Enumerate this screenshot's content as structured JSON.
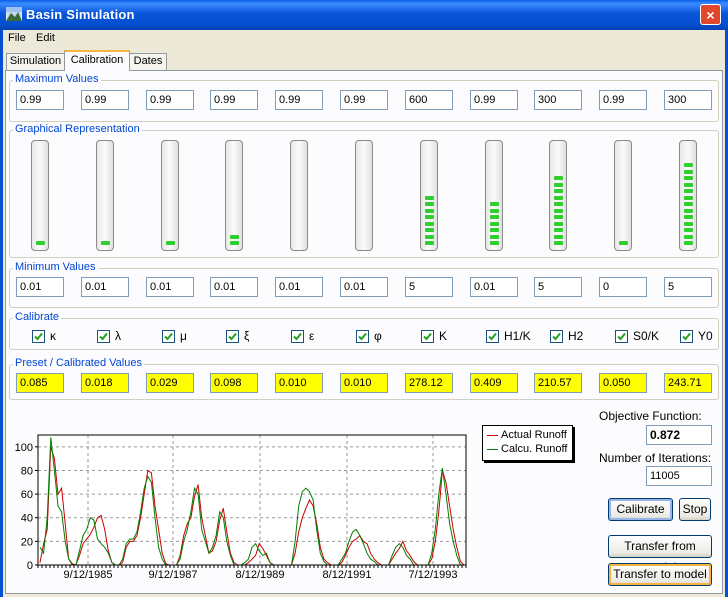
{
  "window": {
    "title": "Basin Simulation",
    "close_glyph": "×"
  },
  "menu": [
    "File",
    "Edit"
  ],
  "tabs": [
    "Simulation",
    "Calibration",
    "Dates"
  ],
  "active_tab": "Calibration",
  "groups": {
    "max": "Maximum Values",
    "graph": "Graphical Representation",
    "min": "Minimum Values",
    "calibrate": "Calibrate",
    "preset": "Preset / Calibrated Values"
  },
  "max_values": [
    "0.99",
    "0.99",
    "0.99",
    "0.99",
    "0.99",
    "0.99",
    "600",
    "0.99",
    "300",
    "0.99",
    "300"
  ],
  "min_values": [
    "0.01",
    "0.01",
    "0.01",
    "0.01",
    "0.01",
    "0.01",
    "5",
    "0.01",
    "5",
    "0",
    "5"
  ],
  "preset_values": [
    "0.085",
    "0.018",
    "0.029",
    "0.098",
    "0.010",
    "0.010",
    "278.12",
    "0.409",
    "210.57",
    "0.050",
    "243.71"
  ],
  "meter_levels": [
    0.09,
    0.02,
    0.03,
    0.1,
    0.0,
    0.0,
    0.47,
    0.41,
    0.71,
    0.05,
    0.81
  ],
  "params": [
    {
      "label": "κ",
      "checked": true
    },
    {
      "label": "λ",
      "checked": true
    },
    {
      "label": "μ",
      "checked": true
    },
    {
      "label": "ξ",
      "checked": true
    },
    {
      "label": "ε",
      "checked": true
    },
    {
      "label": "φ",
      "checked": true
    },
    {
      "label": "K",
      "checked": true
    },
    {
      "label": "H1/K",
      "checked": true
    },
    {
      "label": "H2",
      "checked": true
    },
    {
      "label": "S0/K",
      "checked": true
    },
    {
      "label": "Y0",
      "checked": true
    }
  ],
  "objective": {
    "label": "Objective Function:",
    "value": "0.872"
  },
  "iterations": {
    "label": "Number of Iterations:",
    "value": "11005"
  },
  "buttons": {
    "calibrate": "Calibrate",
    "stop": "Stop",
    "transfer_from": "Transfer from model",
    "transfer_to": "Transfer to model"
  },
  "colors": {
    "actual": "#cc0000",
    "calculated": "#007f00",
    "meter_fill": "#2fcf2f",
    "preset_bg": "#ffff00"
  },
  "chart_data": {
    "type": "line",
    "ylim": [
      0,
      110
    ],
    "yticks": [
      0,
      20,
      40,
      60,
      80,
      100
    ],
    "xticks": [
      "9/12/1985",
      "9/12/1987",
      "8/12/1989",
      "8/12/1991",
      "7/12/1993"
    ],
    "grid": true,
    "legend_position": "top-right",
    "series": [
      {
        "name": "Actual Runoff",
        "values": [
          2,
          18,
          30,
          100,
          90,
          60,
          65,
          35,
          5,
          1,
          0,
          8,
          18,
          22,
          26,
          32,
          40,
          42,
          30,
          12,
          2,
          0,
          0,
          2,
          15,
          20,
          20,
          25,
          40,
          60,
          80,
          78,
          50,
          30,
          10,
          1,
          0,
          0,
          0,
          8,
          25,
          35,
          40,
          58,
          68,
          40,
          25,
          10,
          12,
          20,
          38,
          48,
          28,
          10,
          2,
          0,
          0,
          0,
          2,
          5,
          8,
          18,
          14,
          8,
          2,
          0,
          0,
          0,
          0,
          0,
          0,
          10,
          28,
          40,
          48,
          55,
          50,
          35,
          15,
          5,
          2,
          0,
          0,
          0,
          2,
          8,
          15,
          20,
          22,
          25,
          20,
          18,
          10,
          5,
          2,
          0,
          0,
          0,
          5,
          10,
          14,
          20,
          12,
          8,
          3,
          0,
          0,
          0,
          0,
          5,
          20,
          45,
          80,
          70,
          50,
          30,
          15,
          3,
          0
        ]
      },
      {
        "name": "Calcu. Runoff",
        "values": [
          15,
          10,
          40,
          108,
          80,
          50,
          45,
          20,
          5,
          0,
          0,
          12,
          25,
          30,
          40,
          38,
          22,
          18,
          15,
          10,
          2,
          0,
          0,
          5,
          18,
          22,
          22,
          28,
          45,
          65,
          75,
          70,
          40,
          15,
          5,
          0,
          0,
          0,
          0,
          5,
          20,
          30,
          45,
          65,
          60,
          30,
          20,
          10,
          15,
          25,
          45,
          40,
          20,
          8,
          0,
          0,
          0,
          2,
          5,
          15,
          18,
          12,
          8,
          10,
          2,
          0,
          0,
          0,
          0,
          0,
          0,
          20,
          50,
          62,
          65,
          62,
          55,
          30,
          10,
          3,
          0,
          0,
          0,
          0,
          5,
          10,
          20,
          28,
          30,
          25,
          18,
          10,
          5,
          3,
          0,
          0,
          0,
          0,
          8,
          15,
          18,
          15,
          8,
          5,
          0,
          0,
          0,
          0,
          0,
          10,
          30,
          60,
          82,
          60,
          35,
          20,
          8,
          0,
          0
        ]
      }
    ]
  }
}
